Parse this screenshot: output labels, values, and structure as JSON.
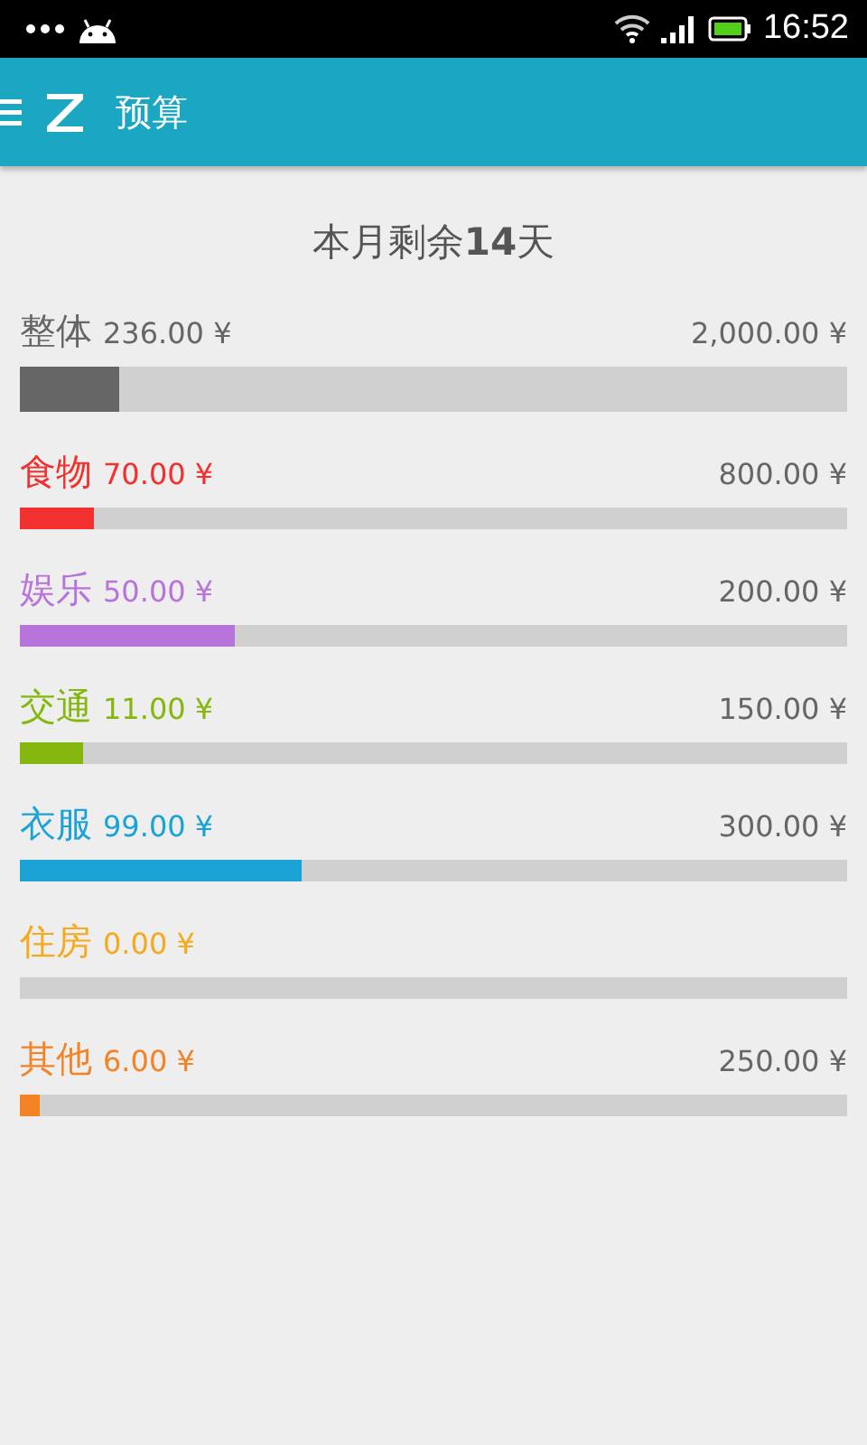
{
  "status_bar": {
    "time": "16:52"
  },
  "app_bar": {
    "title": "预算"
  },
  "summary": "本月剩余**14**天",
  "budgets": [
    {
      "kind": "total",
      "name": "整体",
      "spent": "236.00 ¥",
      "budget": "2,000.00 ¥",
      "level": 0.12,
      "color": "#666666"
    },
    {
      "kind": "category",
      "name": "食物",
      "spent": "70.00 ¥",
      "budget": "800.00 ¥",
      "level": 0.09,
      "color": "#f23030"
    },
    {
      "kind": "category",
      "name": "娱乐",
      "spent": "50.00 ¥",
      "budget": "200.00 ¥",
      "level": 0.26,
      "color": "#b775dc"
    },
    {
      "kind": "category",
      "name": "交通",
      "spent": "11.00 ¥",
      "budget": "150.00 ¥",
      "level": 0.076,
      "color": "#86b70e"
    },
    {
      "kind": "category",
      "name": "衣服",
      "spent": "99.00 ¥",
      "budget": "300.00 ¥",
      "level": 0.34,
      "color": "#1ba3d6"
    },
    {
      "kind": "category",
      "name": "住房",
      "spent": "0.00 ¥",
      "color": "#f6a91c"
    },
    {
      "kind": "category",
      "name": "其他",
      "spent": "6.00 ¥",
      "budget": "250.00 ¥",
      "level": 0.024,
      "color": "#f48326"
    }
  ]
}
